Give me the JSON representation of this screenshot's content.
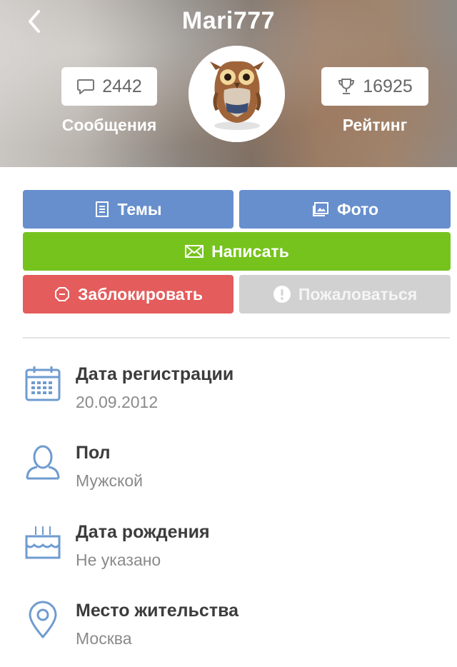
{
  "profile": {
    "username": "Mari777",
    "messages": {
      "count": "2442",
      "label": "Сообщения",
      "icon": "chat-bubble-icon"
    },
    "rating": {
      "count": "16925",
      "label": "Рейтинг",
      "icon": "trophy-icon"
    }
  },
  "actions": {
    "topics": "Темы",
    "photo": "Фото",
    "write": "Написать",
    "block": "Заблокировать",
    "report": "Пожаловаться"
  },
  "info": [
    {
      "label": "Дата регистрации",
      "value": "20.09.2012",
      "icon": "calendar-icon"
    },
    {
      "label": "Пол",
      "value": "Мужской",
      "icon": "person-icon"
    },
    {
      "label": "Дата рождения",
      "value": "Не указано",
      "icon": "birthday-cake-icon"
    },
    {
      "label": "Место жительства",
      "value": "Москва",
      "icon": "location-pin-icon"
    }
  ],
  "colors": {
    "blue_button": "#678fcd",
    "green_button": "#76c31d",
    "red_button": "#e45c5c",
    "gray_button": "#d1d1d1",
    "icon_blue": "#6f9bd0"
  }
}
